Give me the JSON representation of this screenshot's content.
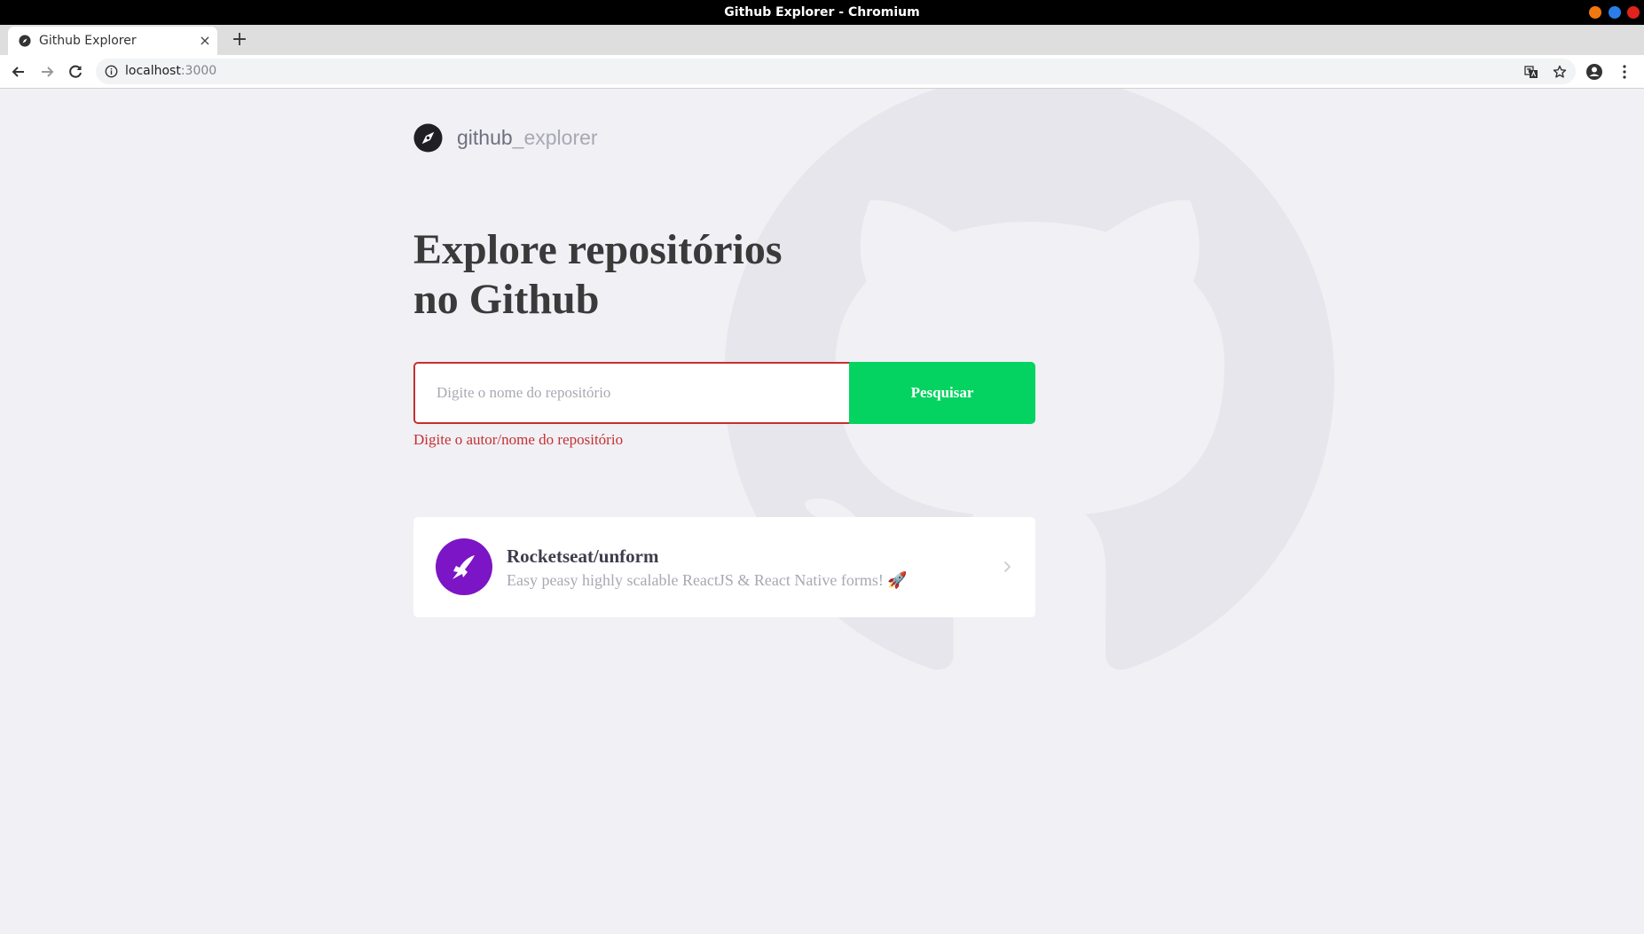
{
  "window": {
    "title": "Github Explorer - Chromium"
  },
  "tabs": [
    {
      "title": "Github Explorer",
      "close_glyph": "×"
    }
  ],
  "new_tab_glyph": "+",
  "address_bar": {
    "host": "localhost",
    "port": ":3000"
  },
  "colors": {
    "page_bg": "#f0f0f5",
    "accent_green": "#04d361",
    "error_red": "#c53030",
    "avatar_purple": "#7c15c5"
  },
  "brand": {
    "strong": "github",
    "light": "_explorer",
    "icon": "compass-icon"
  },
  "hero": {
    "line1": "Explore repositórios",
    "line2": "no Github"
  },
  "search": {
    "value": "",
    "placeholder": "Digite o nome do repositório",
    "button_label": "Pesquisar",
    "error": "Digite o autor/nome do repositório"
  },
  "repositories": [
    {
      "name": "Rocketseat/unform",
      "description": "Easy peasy highly scalable ReactJS & React Native forms! 🚀",
      "avatar_icon": "unform-logo-icon",
      "chevron_icon": "chevron-right-icon"
    }
  ]
}
